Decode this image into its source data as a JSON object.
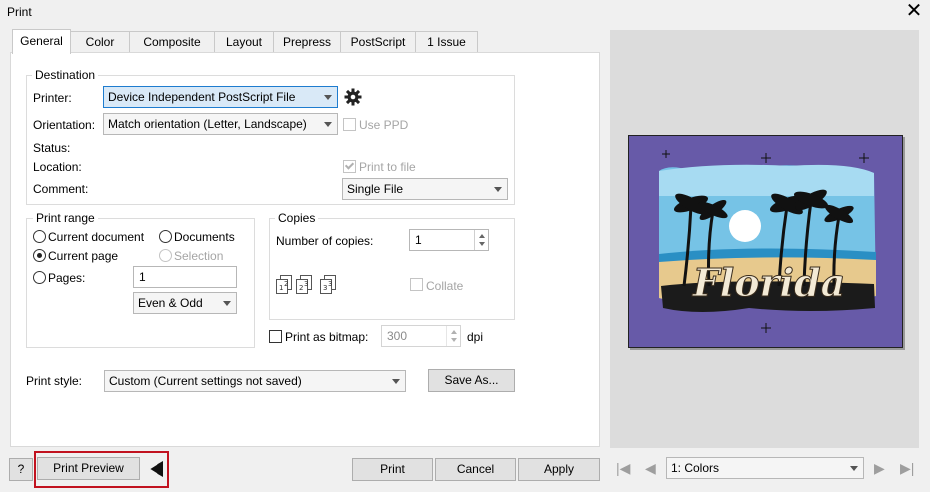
{
  "window": {
    "title": "Print"
  },
  "tabs": [
    {
      "label": "General",
      "active": true
    },
    {
      "label": "Color"
    },
    {
      "label": "Composite"
    },
    {
      "label": "Layout"
    },
    {
      "label": "Prepress"
    },
    {
      "label": "PostScript"
    },
    {
      "label": "1 Issue"
    }
  ],
  "destination": {
    "group_label": "Destination",
    "printer_label": "Printer:",
    "printer_value": "Device Independent PostScript File",
    "orientation_label": "Orientation:",
    "orientation_value": "Match orientation (Letter, Landscape)",
    "use_ppd_label": "Use PPD",
    "status_label": "Status:",
    "location_label": "Location:",
    "print_to_file_label": "Print to file",
    "comment_label": "Comment:",
    "file_mode_value": "Single File"
  },
  "print_range": {
    "group_label": "Print range",
    "current_document": "Current document",
    "documents": "Documents",
    "current_page": "Current page",
    "selection": "Selection",
    "pages_label": "Pages:",
    "pages_value": "1",
    "page_set_value": "Even & Odd"
  },
  "copies": {
    "group_label": "Copies",
    "number_label": "Number of copies:",
    "number_value": "1",
    "collate_label": "Collate"
  },
  "bitmap": {
    "label": "Print as bitmap:",
    "dpi_value": "300",
    "dpi_unit": "dpi"
  },
  "print_style": {
    "label": "Print style:",
    "value": "Custom (Current settings not saved)",
    "save_as": "Save As..."
  },
  "buttons": {
    "help": "?",
    "print_preview": "Print Preview",
    "print": "Print",
    "cancel": "Cancel",
    "apply": "Apply"
  },
  "preview": {
    "artwork_text": "Florida",
    "plate_value": "1: Colors"
  },
  "colors": {
    "page_bg": "#675aa8",
    "highlight": "#c1121f",
    "accent": "#1e7ccf"
  }
}
